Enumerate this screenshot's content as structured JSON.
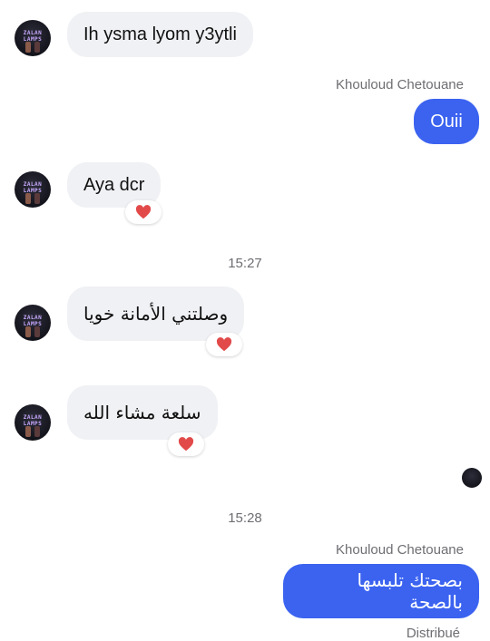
{
  "messages": [
    {
      "text": "Ih ysma lyom y3ytli"
    },
    {
      "sender": "Khouloud Chetouane",
      "text": "Ouii"
    },
    {
      "text": "Aya dcr"
    },
    {
      "time": "15:27"
    },
    {
      "text": "وصلتني الأمانة خويا"
    },
    {
      "text": "سلعة مشاء الله"
    },
    {
      "time": "15:28"
    },
    {
      "sender": "Khouloud Chetouane",
      "text": "بصحتك تلبسها بالصحة"
    }
  ],
  "avatar": {
    "neon_text": "ZALAN LAMPS"
  },
  "reaction_emoji": "heart-icon",
  "status_text": "Distribué",
  "colors": {
    "outgoing": "#3b63f0",
    "incoming": "#f0f1f4",
    "heart": "#e24a4a",
    "meta_text": "#6e6e73"
  }
}
